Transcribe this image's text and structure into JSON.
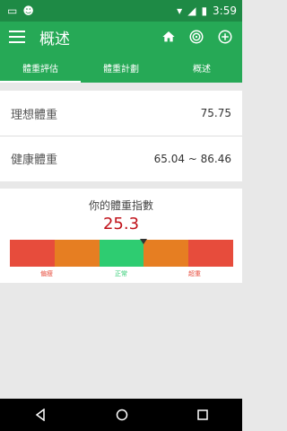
{
  "status_bar": {
    "time": "3:59"
  },
  "app_bar": {
    "title": "概述",
    "menu_icon": "menu-icon",
    "actions": [
      "home-icon",
      "target-icon",
      "add-circle-icon"
    ]
  },
  "tabs": [
    {
      "label": "體重評估",
      "active": true
    },
    {
      "label": "體重計劃",
      "active": false
    },
    {
      "label": "概述",
      "active": false
    }
  ],
  "weight_rows": [
    {
      "label": "理想體重",
      "value": "75.75"
    },
    {
      "label": "健康體重",
      "value": "65.04 ~ 86.46"
    }
  ],
  "bmi": {
    "title": "你的體重指數",
    "value": "25.3",
    "value_color": "#c0121a",
    "scale_labels": [
      "偏瘦",
      "正常",
      "超重"
    ],
    "segment_colors": [
      "#e74c3c",
      "#e67e22",
      "#2ecc71",
      "#e67e22",
      "#e74c3c"
    ],
    "pointer_fraction": 0.6
  },
  "colors": {
    "primary": "#26a956",
    "primary_dark": "#1e8a45"
  }
}
